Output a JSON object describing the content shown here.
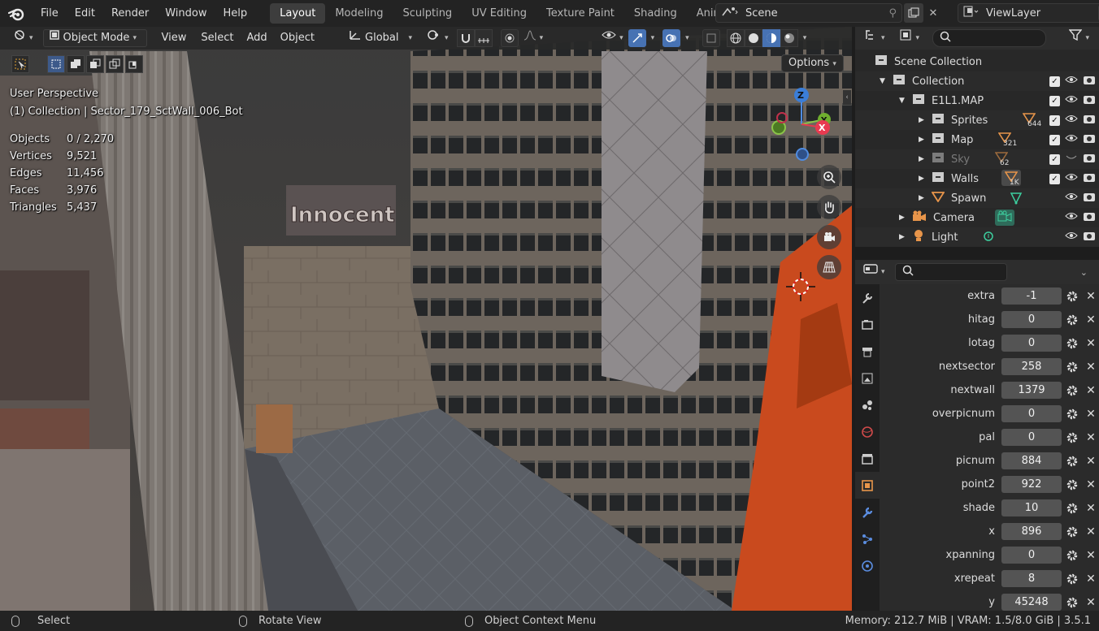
{
  "topbar": {
    "menus": [
      "File",
      "Edit",
      "Render",
      "Window",
      "Help"
    ],
    "workspace_tabs": [
      "Layout",
      "Modeling",
      "Sculpting",
      "UV Editing",
      "Texture Paint",
      "Shading",
      "Animati"
    ],
    "active_tab": "Layout",
    "scene_name": "Scene",
    "view_layer_name": "ViewLayer"
  },
  "viewport": {
    "mode": "Object Mode",
    "menus": [
      "View",
      "Select",
      "Add",
      "Object"
    ],
    "transform_orientation": "Global",
    "options_label": "Options",
    "overlay": {
      "view_name": "User Perspective",
      "active": "(1) Collection | Sector_179_SctWall_006_Bot"
    },
    "stats": [
      {
        "label": "Objects",
        "value": "0 / 2,270"
      },
      {
        "label": "Vertices",
        "value": "9,521"
      },
      {
        "label": "Edges",
        "value": "11,456"
      },
      {
        "label": "Faces",
        "value": "3,976"
      },
      {
        "label": "Triangles",
        "value": "5,437"
      }
    ],
    "sign_text": "Innocent",
    "gizmo_axes": {
      "z": "Z",
      "y": "Y",
      "x": "X"
    }
  },
  "outliner": {
    "root": "Scene Collection",
    "items": [
      {
        "label": "Collection"
      },
      {
        "label": "E1L1.MAP"
      },
      {
        "label": "Sprites",
        "count": "644"
      },
      {
        "label": "Map",
        "count": "321"
      },
      {
        "label": "Sky",
        "count": "62"
      },
      {
        "label": "Walls",
        "count": "1K"
      },
      {
        "label": "Spawn"
      },
      {
        "label": "Camera"
      },
      {
        "label": "Light"
      }
    ]
  },
  "properties": {
    "fields": [
      {
        "name": "extra",
        "value": "-1"
      },
      {
        "name": "hitag",
        "value": "0"
      },
      {
        "name": "lotag",
        "value": "0"
      },
      {
        "name": "nextsector",
        "value": "258"
      },
      {
        "name": "nextwall",
        "value": "1379"
      },
      {
        "name": "overpicnum",
        "value": "0"
      },
      {
        "name": "pal",
        "value": "0"
      },
      {
        "name": "picnum",
        "value": "884"
      },
      {
        "name": "point2",
        "value": "922"
      },
      {
        "name": "shade",
        "value": "10"
      },
      {
        "name": "x",
        "value": "896"
      },
      {
        "name": "xpanning",
        "value": "0"
      },
      {
        "name": "xrepeat",
        "value": "8"
      },
      {
        "name": "y",
        "value": "45248"
      }
    ]
  },
  "statusbar": {
    "left_action": "Select",
    "middle_action": "Rotate View",
    "right_action": "Object Context Menu",
    "memory": "Memory: 212.7 MiB | VRAM: 1.5/8.0 GiB | 3.5.1"
  }
}
